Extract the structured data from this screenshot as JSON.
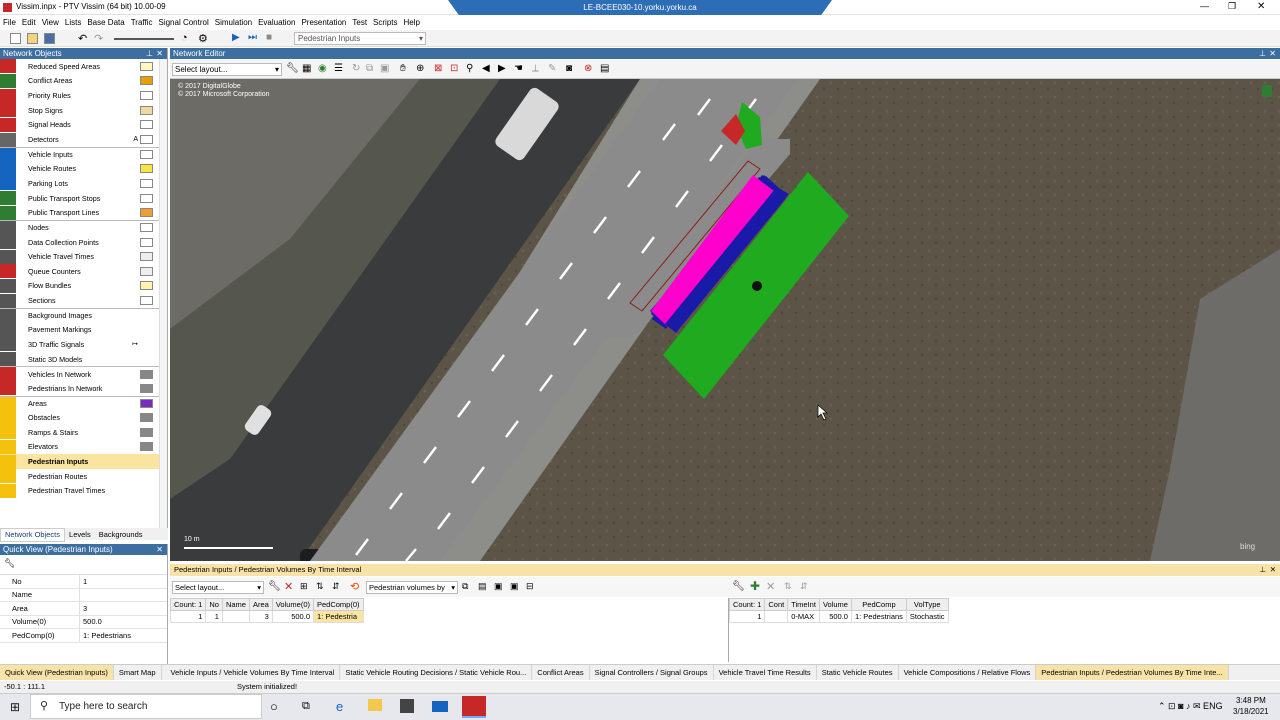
{
  "window": {
    "title": "Vissim.inpx - PTV Vissim (64 bit) 10.00-09",
    "remote_host": "LE-BCEE030-10.yorku.yorku.ca"
  },
  "menu": [
    "File",
    "Edit",
    "View",
    "Lists",
    "Base Data",
    "Traffic",
    "Signal Control",
    "Simulation",
    "Evaluation",
    "Presentation",
    "Test",
    "Scripts",
    "Help"
  ],
  "toolbar": {
    "dropdown_value": "Pedestrian Inputs"
  },
  "left_panel": {
    "title": "Network Objects",
    "items": [
      {
        "label": "Reduced Speed Areas",
        "icon": "reduced-speed-icon",
        "color": "#c62828",
        "swatch": "#fff8c0",
        "group_start": false
      },
      {
        "label": "Conflict Areas",
        "icon": "conflict-area-icon",
        "color": "#2e7d32",
        "swatch": "#e8a000",
        "group_start": false
      },
      {
        "label": "Priority Rules",
        "icon": "priority-rule-icon",
        "color": "#c62828",
        "swatch": "#ffffff",
        "group_start": false
      },
      {
        "label": "Stop Signs",
        "icon": "stop-sign-icon",
        "color": "#c62828",
        "swatch": "#f0d8a0",
        "group_start": false
      },
      {
        "label": "Signal Heads",
        "icon": "signal-head-icon",
        "color": "#c62828",
        "swatch": "#ffffff",
        "group_start": false
      },
      {
        "label": "Detectors",
        "icon": "detector-icon",
        "color": "#666666",
        "swatch": "#ffffff",
        "group_start": false,
        "extra": "A"
      },
      {
        "label": "Vehicle Inputs",
        "icon": "vehicle-input-icon",
        "color": "#1565c0",
        "swatch": "#ffffff",
        "group_start": true
      },
      {
        "label": "Vehicle Routes",
        "icon": "vehicle-route-icon",
        "color": "#1565c0",
        "swatch": "#f5e642",
        "group_start": false
      },
      {
        "label": "Parking Lots",
        "icon": "parking-icon",
        "color": "#1565c0",
        "swatch": "#ffffff",
        "group_start": false
      },
      {
        "label": "Public Transport Stops",
        "icon": "pt-stop-icon",
        "color": "#2e7d32",
        "swatch": "#ffffff",
        "group_start": false
      },
      {
        "label": "Public Transport Lines",
        "icon": "pt-line-icon",
        "color": "#2e7d32",
        "swatch": "#f39c33",
        "group_start": false
      },
      {
        "label": "Nodes",
        "icon": "node-icon",
        "color": "#555555",
        "swatch": "#ffffff",
        "group_start": true
      },
      {
        "label": "Data Collection Points",
        "icon": "data-collection-icon",
        "color": "#555555",
        "swatch": "#ffffff",
        "group_start": false
      },
      {
        "label": "Vehicle Travel Times",
        "icon": "travel-time-icon",
        "color": "#555555",
        "swatch": "#eeeeee",
        "group_start": false
      },
      {
        "label": "Queue Counters",
        "icon": "queue-counter-icon",
        "color": "#c62828",
        "swatch": "#eeeeee",
        "group_start": false
      },
      {
        "label": "Flow Bundles",
        "icon": "flow-bundle-icon",
        "color": "#555555",
        "swatch": "#fff3b0",
        "group_start": false
      },
      {
        "label": "Sections",
        "icon": "section-icon",
        "color": "#555555",
        "swatch": "#ffffff",
        "group_start": false
      },
      {
        "label": "Background Images",
        "icon": "background-image-icon",
        "color": "#555555",
        "swatch": "",
        "group_start": true
      },
      {
        "label": "Pavement Markings",
        "icon": "pavement-marking-icon",
        "color": "#555555",
        "swatch": "",
        "group_start": false
      },
      {
        "label": "3D Traffic Signals",
        "icon": "3d-signal-icon",
        "color": "#555555",
        "swatch": "",
        "group_start": false,
        "extra": "↦"
      },
      {
        "label": "Static 3D Models",
        "icon": "static-3d-icon",
        "color": "#555555",
        "swatch": "",
        "group_start": false
      },
      {
        "label": "Vehicles In Network",
        "icon": "vehicle-network-icon",
        "color": "#c62828",
        "swatch": "#888888",
        "group_start": true
      },
      {
        "label": "Pedestrians In Network",
        "icon": "pedestrian-network-icon",
        "color": "#c62828",
        "swatch": "#888888",
        "group_start": false
      },
      {
        "label": "Areas",
        "icon": "area-icon",
        "color": "#f4c20d",
        "swatch": "#7b2cbf",
        "group_start": true
      },
      {
        "label": "Obstacles",
        "icon": "obstacle-icon",
        "color": "#f4c20d",
        "swatch": "#888888",
        "group_start": false
      },
      {
        "label": "Ramps & Stairs",
        "icon": "ramp-icon",
        "color": "#f4c20d",
        "swatch": "#888888",
        "group_start": false
      },
      {
        "label": "Elevators",
        "icon": "elevator-icon",
        "color": "#f4c20d",
        "swatch": "#888888",
        "group_start": false
      },
      {
        "label": "Pedestrian Inputs",
        "icon": "pedestrian-input-icon",
        "color": "#f4c20d",
        "swatch": "",
        "group_start": false,
        "selected": true
      },
      {
        "label": "Pedestrian Routes",
        "icon": "pedestrian-route-icon",
        "color": "#f4c20d",
        "swatch": "",
        "group_start": false
      },
      {
        "label": "Pedestrian Travel Times",
        "icon": "pedestrian-travel-time-icon",
        "color": "#f4c20d",
        "swatch": "",
        "group_start": false
      }
    ],
    "tabs": [
      "Network Objects",
      "Levels",
      "Backgrounds"
    ]
  },
  "quick_view": {
    "title": "Quick View (Pedestrian Inputs)",
    "rows": [
      {
        "key": "No",
        "value": "1"
      },
      {
        "key": "Name",
        "value": ""
      },
      {
        "key": "Area",
        "value": "3"
      },
      {
        "key": "Volume(0)",
        "value": "500.0"
      },
      {
        "key": "PedComp(0)",
        "value": "1: Pedestrians"
      }
    ]
  },
  "editor": {
    "title": "Network Editor",
    "layout_placeholder": "Select layout...",
    "copyright_1": "© 2017 DigitalGlobe",
    "copyright_2": "© 2017 Microsoft Corporation",
    "scale": "10 m",
    "bing": "bing"
  },
  "bottom": {
    "title": "Pedestrian Inputs / Pedestrian Volumes By Time Interval",
    "layout_placeholder": "Select layout...",
    "relation_dropdown": "Pedestrian volumes by",
    "left_table": {
      "headers": [
        "Count: 1",
        "No",
        "Name",
        "Area",
        "Volume(0)",
        "PedComp(0)"
      ],
      "rows": [
        [
          "1",
          "1",
          "",
          "3",
          "500.0",
          "1: Pedestria"
        ]
      ]
    },
    "right_table": {
      "headers": [
        "Count: 1",
        "Cont",
        "TimeInt",
        "Volume",
        "PedComp",
        "VolType"
      ],
      "rows": [
        [
          "1",
          "",
          "0-MAX",
          "500.0",
          "1: Pedestrians",
          "Stochastic"
        ]
      ]
    }
  },
  "bottom_tabs": [
    "Quick View (Pedestrian Inputs)",
    "Smart Map",
    "Vehicle Inputs / Vehicle Volumes By Time Interval",
    "Static Vehicle Routing Decisions / Static Vehicle Rou...",
    "Conflict Areas",
    "Signal Controllers / Signal Groups",
    "Vehicle Travel Time Results",
    "Static Vehicle Routes",
    "Vehicle Compositions / Relative Flows",
    "Pedestrian Inputs / Pedestrian Volumes By Time Inte..."
  ],
  "status": {
    "coords": "-50.1 : 111.1",
    "message": "System initialized!"
  },
  "taskbar": {
    "search_placeholder": "Type here to search",
    "time": "3:48 PM",
    "date": "3/18/2021"
  },
  "colors": {
    "accent": "#3c6ea0",
    "selected_tab": "#f7e3a8",
    "area_green": "#1faa1f",
    "area_magenta": "#ff00cc",
    "area_blue": "#1a1aa8"
  }
}
